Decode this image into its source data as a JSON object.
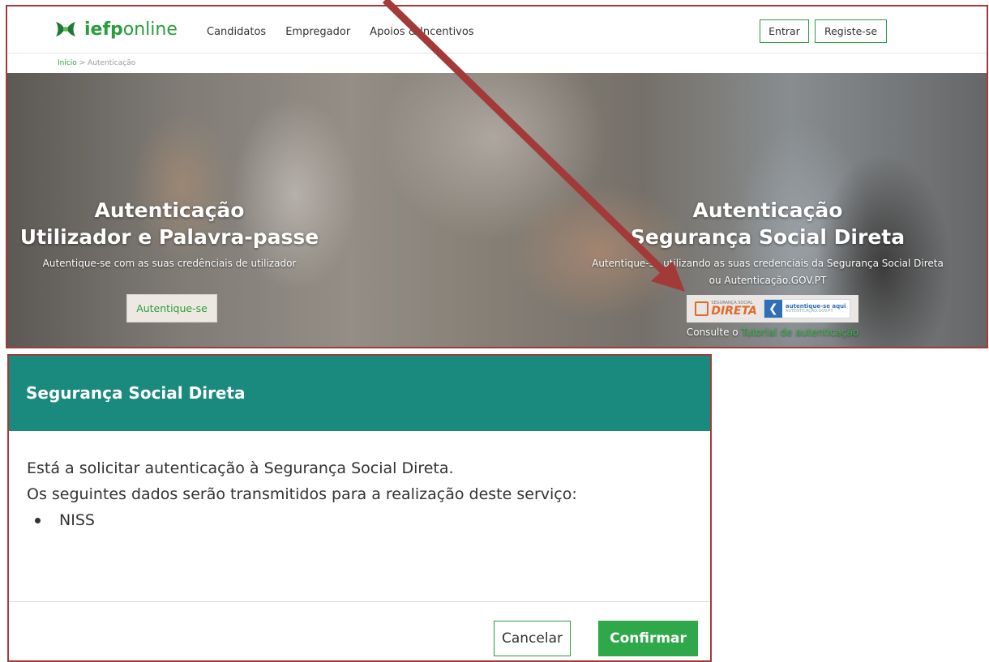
{
  "site": {
    "logo": {
      "bold": "iefp",
      "light": "online"
    },
    "nav": [
      "Candidatos",
      "Empregador",
      "Apoios & Incentivos"
    ],
    "buttons": {
      "login": "Entrar",
      "register": "Registe-se"
    },
    "breadcrumb": {
      "home": "Início",
      "separator": ">",
      "current": "Autenticação"
    }
  },
  "hero": {
    "left": {
      "title_line1": "Autenticação",
      "title_line2": "Utilizador e Palavra-passe",
      "description": "Autentique-se com as suas credênciais de utilizador",
      "button": "Autentique-se"
    },
    "right": {
      "title_line1": "Autenticação",
      "title_line2": "Segurança Social Direta",
      "description_line1": "Autentique-se utilizando as suas credenciais da Segurança Social Direta",
      "description_line2": "ou Autenticação.GOV.PT",
      "badge_ssd_small": "SEGURANÇA SOCIAL",
      "badge_ssd_big": "DIRETA",
      "badge_gov_line1": "autentique-se aqui",
      "badge_gov_line2": "AUTENTICAÇÃO.GOV.PT",
      "consulte_prefix": "Consulte o",
      "consulte_link": "Tutorial de autenticação"
    }
  },
  "dialog": {
    "title": "Segurança Social Direta",
    "line1": "Está a solicitar autenticação à Segurança Social Direta.",
    "line2": "Os seguintes dados serão transmitidos para a realização deste serviço:",
    "items": [
      "NISS"
    ],
    "cancel": "Cancelar",
    "confirm": "Confirmar"
  },
  "colors": {
    "brand_green": "#2a9d3c",
    "dialog_header": "#1a8a7e",
    "annotation_red": "#a33a3a"
  }
}
